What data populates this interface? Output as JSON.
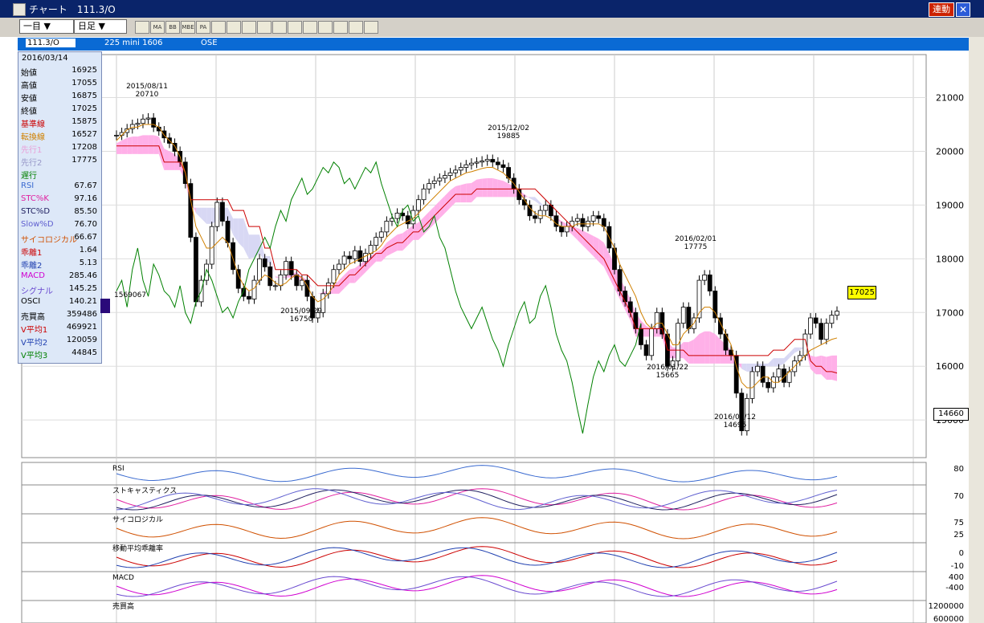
{
  "window": {
    "title": "チャート　111.3/O",
    "link_label": "連動",
    "close_label": "✕"
  },
  "toolbar": {
    "period": "一目 ▼",
    "interval": "日足 ▼",
    "icons": [
      "line-icon",
      "ma-icon",
      "bb-icon",
      "mbe-icon",
      "pa-icon",
      "candle-icon",
      "cross-icon",
      "compare-icon",
      "zoom-icon",
      "calc-icon",
      "ruler-icon",
      "pencil-icon",
      "cursor-icon",
      "eraser-icon",
      "tools-icon",
      "fib-icon"
    ],
    "icon_labels": [
      "",
      "MA",
      "BB",
      "MBE",
      "PA",
      "",
      "",
      "",
      "",
      "",
      "",
      "",
      "",
      "",
      "",
      ""
    ]
  },
  "header": {
    "code": "111.3/O",
    "name": "225 mini 1606",
    "exchange": "OSE"
  },
  "info": {
    "date": "2016/03/14",
    "rows": [
      {
        "label": "始値",
        "value": "16925",
        "color": "#000000"
      },
      {
        "label": "高値",
        "value": "17055",
        "color": "#000000"
      },
      {
        "label": "安値",
        "value": "16875",
        "color": "#000000"
      },
      {
        "label": "終値",
        "value": "17025",
        "color": "#000000"
      },
      {
        "label": "基準線",
        "value": "15875",
        "color": "#cc0000"
      },
      {
        "label": "転換線",
        "value": "16527",
        "color": "#d08000"
      },
      {
        "label": "先行1",
        "value": "17208",
        "color": "#e8a0d8"
      },
      {
        "label": "先行2",
        "value": "17775",
        "color": "#9898c8"
      },
      {
        "label": "遅行",
        "value": "",
        "color": "#008000"
      },
      {
        "label": "RSI",
        "value": "67.67",
        "color": "#3a6ad0"
      },
      {
        "label": "STC%K",
        "value": "97.16",
        "color": "#e020a0"
      },
      {
        "label": "STC%D",
        "value": "85.50",
        "color": "#202060"
      },
      {
        "label": "Slow%D",
        "value": "76.70",
        "color": "#6060d0"
      },
      {
        "label": "サイコロジカル",
        "value": "66.67",
        "color": "#d05000"
      },
      {
        "label": "乖離1",
        "value": "1.64",
        "color": "#cc0000"
      },
      {
        "label": "乖離2",
        "value": "5.13",
        "color": "#2040b0"
      },
      {
        "label": "MACD",
        "value": "285.46",
        "color": "#d000d0"
      },
      {
        "label": "シグナル",
        "value": "145.25",
        "color": "#6a4ad0"
      },
      {
        "label": "OSCI",
        "value": "140.21",
        "color": "#000000"
      },
      {
        "label": "売買高",
        "value": "359486",
        "color": "#000000"
      },
      {
        "label": "V平均1",
        "value": "469921",
        "color": "#cc0000"
      },
      {
        "label": "V平均2",
        "value": "120059",
        "color": "#2040b0"
      },
      {
        "label": "V平均3",
        "value": "44845",
        "color": "#008000"
      }
    ]
  },
  "price_tag": "17025",
  "low_tag": "14660",
  "volume_tag": "1569067",
  "chart_data": {
    "type": "candlestick",
    "y_axis_ticks": [
      "21000",
      "20000",
      "19000",
      "18000",
      "17000",
      "16000",
      "15000"
    ],
    "ylim": [
      14300,
      21800
    ],
    "annotations": [
      {
        "date": "2015/08/11",
        "value": "20710"
      },
      {
        "date": "2015/09/29",
        "value": "16750"
      },
      {
        "date": "2015/12/02",
        "value": "19885"
      },
      {
        "date": "2016/01/22",
        "value": "15665"
      },
      {
        "date": "2016/02/01",
        "value": "17775"
      },
      {
        "date": "2016/02/12",
        "value": "14695"
      }
    ],
    "close": [
      20300,
      20350,
      20420,
      20500,
      20520,
      20600,
      20620,
      20450,
      20380,
      20250,
      20150,
      20000,
      19800,
      19400,
      18400,
      17200,
      17600,
      17900,
      18600,
      19050,
      18700,
      18300,
      17800,
      17450,
      17300,
      17250,
      17600,
      18000,
      17850,
      17500,
      17500,
      17700,
      17950,
      17700,
      17500,
      17600,
      17300,
      16900,
      17000,
      17350,
      17550,
      17800,
      17900,
      18050,
      18000,
      18150,
      17950,
      18100,
      18250,
      18400,
      18500,
      18700,
      18750,
      18850,
      18800,
      18650,
      18900,
      19100,
      19300,
      19400,
      19450,
      19500,
      19550,
      19600,
      19650,
      19700,
      19750,
      19780,
      19800,
      19820,
      19850,
      19800,
      19750,
      19700,
      19500,
      19300,
      19100,
      19000,
      18800,
      18750,
      18900,
      19000,
      18800,
      18600,
      18500,
      18600,
      18700,
      18750,
      18600,
      18700,
      18800,
      18750,
      18600,
      18200,
      17800,
      17400,
      17200,
      17000,
      16700,
      16400,
      16200,
      16700,
      17000,
      16600,
      16000,
      16100,
      16800,
      17100,
      16700,
      16900,
      17600,
      17700,
      17400,
      16900,
      16600,
      16300,
      16200,
      15500,
      14800,
      15400,
      15900,
      16000,
      15700,
      15600,
      15800,
      15950,
      15700,
      15900,
      16100,
      16200,
      16600,
      16900,
      16800,
      16500,
      16800,
      16950,
      17025
    ],
    "kijun": [
      20100,
      20100,
      20100,
      20100,
      20100,
      20100,
      20100,
      20100,
      20100,
      19800,
      19800,
      19800,
      19800,
      19600,
      19100,
      19100,
      19100,
      19100,
      19100,
      19100,
      19100,
      19100,
      18900,
      18900,
      18900,
      18600,
      18600,
      18600,
      18200,
      18200,
      17800,
      17800,
      17800,
      17800,
      17800,
      17700,
      17700,
      17600,
      17500,
      17500,
      17500,
      17500,
      17500,
      17600,
      17700,
      17700,
      17800,
      17900,
      18000,
      18100,
      18100,
      18200,
      18250,
      18300,
      18300,
      18400,
      18500,
      18500,
      18600,
      18700,
      18800,
      18900,
      19000,
      19100,
      19200,
      19200,
      19200,
      19200,
      19300,
      19300,
      19300,
      19300,
      19300,
      19300,
      19300,
      19300,
      19300,
      19300,
      19300,
      19300,
      19200,
      19100,
      19000,
      18900,
      18800,
      18700,
      18600,
      18500,
      18400,
      18300,
      18200,
      18100,
      18000,
      17800,
      17600,
      17400,
      17200,
      17000,
      16700,
      16700,
      16700,
      16700,
      16700,
      16700,
      16300,
      16300,
      16300,
      16300,
      16200,
      16200,
      16200,
      16200,
      16200,
      16200,
      16200,
      16200,
      16200,
      16200,
      16200,
      16200,
      16200,
      16200,
      16200,
      16200,
      16300,
      16300,
      16300,
      16400,
      16500,
      16500,
      16500,
      16100,
      16000,
      16000,
      15900,
      15900,
      15875
    ],
    "tenkan": [
      20200,
      20300,
      20400,
      20450,
      20450,
      20500,
      20500,
      20500,
      20450,
      20300,
      20200,
      20100,
      19900,
      19600,
      19100,
      18600,
      18400,
      18200,
      18200,
      18300,
      18400,
      18300,
      18000,
      17700,
      17500,
      17400,
      17450,
      17600,
      17700,
      17650,
      17550,
      17500,
      17550,
      17650,
      17700,
      17650,
      17500,
      17300,
      17200,
      17250,
      17350,
      17500,
      17700,
      17800,
      17900,
      17950,
      18000,
      18050,
      18100,
      18150,
      18250,
      18400,
      18500,
      18600,
      18650,
      18700,
      18750,
      18850,
      18950,
      19050,
      19150,
      19250,
      19350,
      19450,
      19500,
      19550,
      19600,
      19620,
      19650,
      19680,
      19700,
      19700,
      19650,
      19600,
      19500,
      19400,
      19250,
      19100,
      18950,
      18850,
      18800,
      18800,
      18750,
      18650,
      18600,
      18600,
      18600,
      18650,
      18650,
      18650,
      18650,
      18650,
      18600,
      18400,
      18200,
      17900,
      17700,
      17500,
      17300,
      17000,
      16800,
      16700,
      16800,
      16800,
      16600,
      16400,
      16400,
      16600,
      16700,
      16800,
      17000,
      17100,
      17100,
      17000,
      16800,
      16600,
      16400,
      16000,
      15700,
      15600,
      15600,
      15700,
      15800,
      15800,
      15700,
      15700,
      15800,
      15900,
      16000,
      16100,
      16200,
      16300,
      16350,
      16400,
      16450,
      16500,
      16527
    ],
    "chikou": [
      17400,
      17600,
      17100,
      17800,
      18200,
      17600,
      17300,
      17900,
      17700,
      17400,
      17300,
      17100,
      17500,
      17000,
      16800,
      17200,
      17400,
      17800,
      17600,
      17300,
      17000,
      17100,
      16900,
      17200,
      17400,
      17800,
      18000,
      18200,
      18400,
      18200,
      18600,
      18900,
      18700,
      19100,
      19300,
      19500,
      19200,
      19300,
      19500,
      19700,
      19600,
      19800,
      19700,
      19400,
      19500,
      19300,
      19500,
      19700,
      19600,
      19800,
      19400,
      19100,
      18800,
      18600,
      18900,
      19000,
      18700,
      18800,
      18500,
      18600,
      18800,
      18400,
      18200,
      17800,
      17400,
      17100,
      16900,
      16700,
      16900,
      17100,
      16800,
      16500,
      16300,
      16000,
      16400,
      16700,
      17000,
      17200,
      16800,
      16900,
      17300,
      17500,
      17100,
      16600,
      16300,
      16100,
      15700,
      15200,
      14750,
      15300,
      15800,
      16100,
      15900,
      16200,
      16400,
      16100,
      16000,
      16200,
      16400,
      16800
    ]
  }
}
